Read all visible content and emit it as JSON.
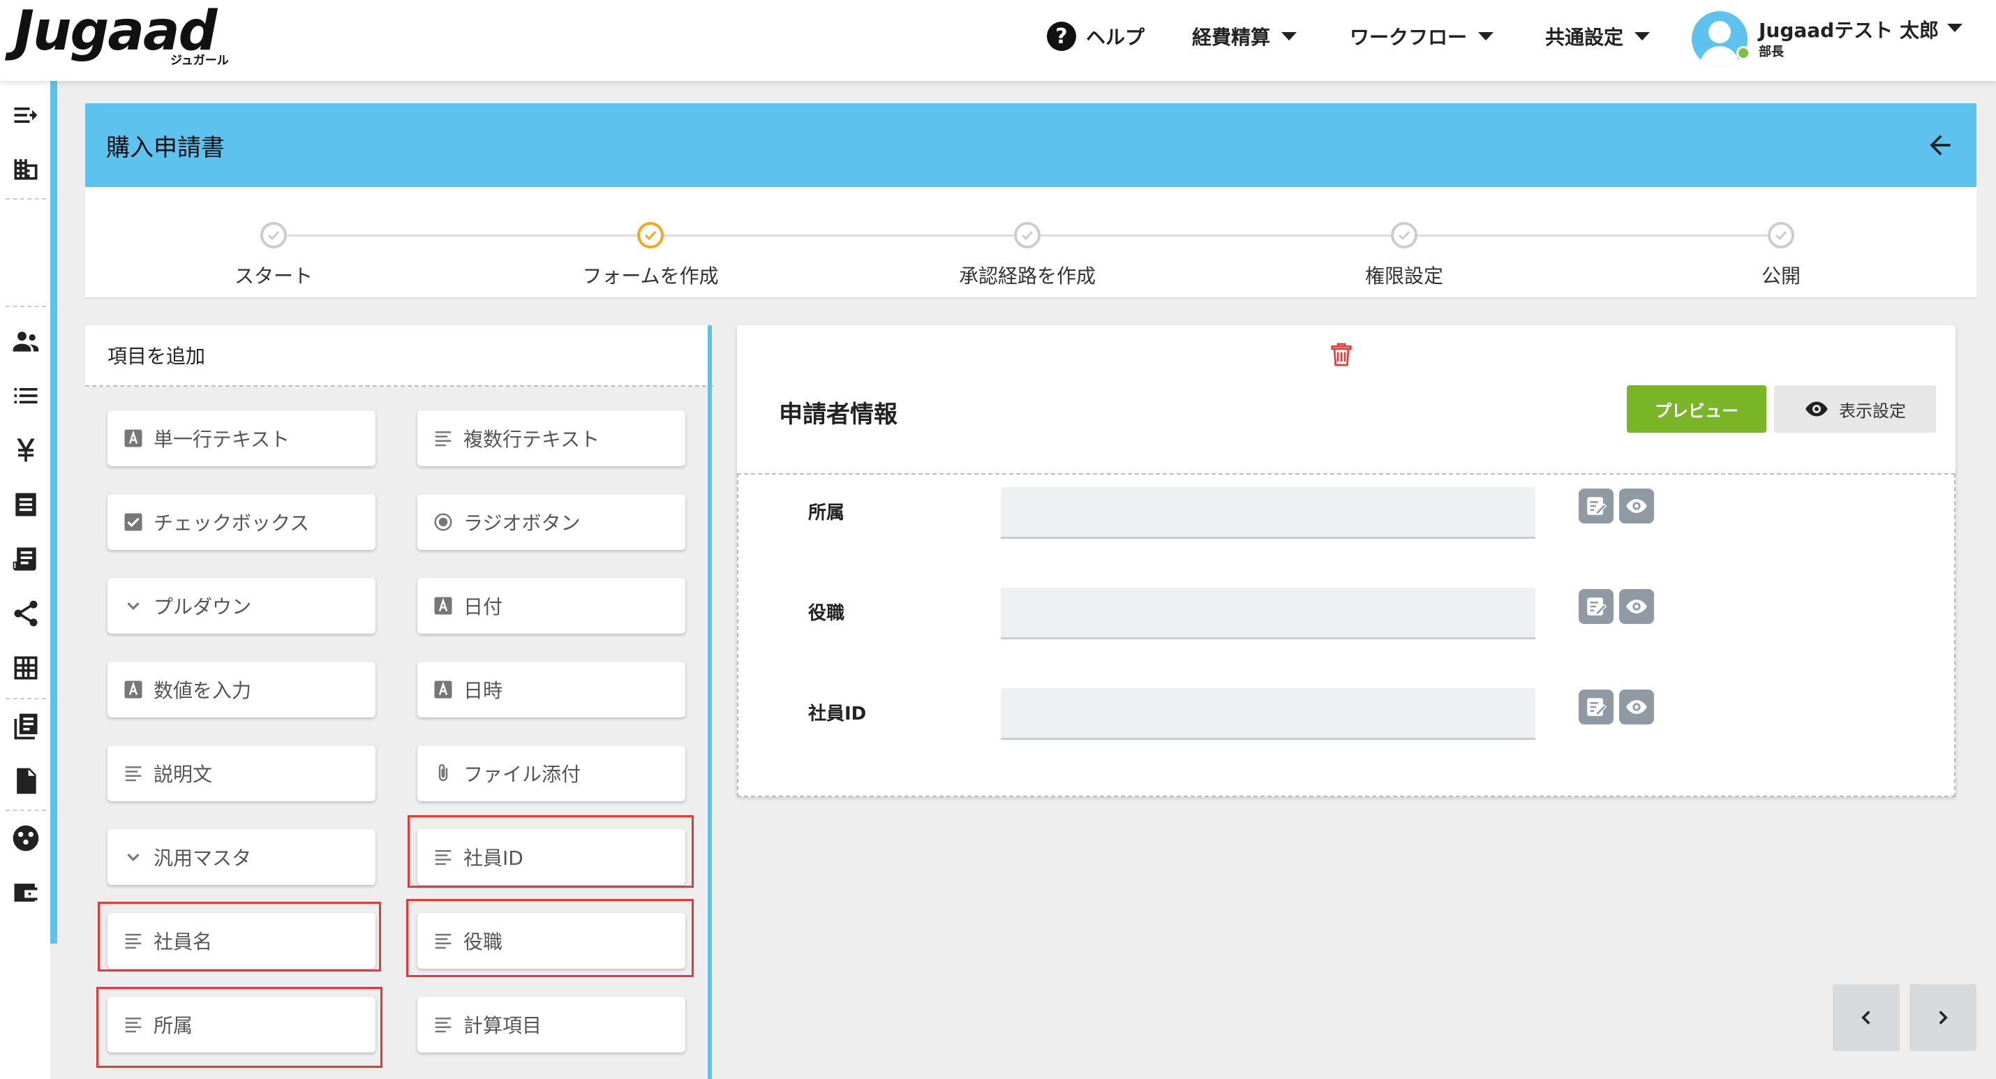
{
  "app": {
    "logo_text": "Jugaad",
    "logo_sub": "ジュガール"
  },
  "topnav": {
    "help": "ヘルプ",
    "expense": "経費精算",
    "workflow": "ワークフロー",
    "common_settings": "共通設定",
    "user_name": "Jugaadテスト 太郎",
    "user_role": "部長"
  },
  "page": {
    "title": "購入申請書"
  },
  "stepper": {
    "steps": [
      {
        "label": "スタート",
        "state": "done"
      },
      {
        "label": "フォームを作成",
        "state": "active"
      },
      {
        "label": "承認経路を作成",
        "state": "done"
      },
      {
        "label": "権限設定",
        "state": "done"
      },
      {
        "label": "公開",
        "state": "done"
      }
    ]
  },
  "palette": {
    "heading": "項目を追加",
    "items": [
      {
        "label": "単一行テキスト",
        "icon": "letter-a-icon"
      },
      {
        "label": "複数行テキスト",
        "icon": "lines-icon"
      },
      {
        "label": "チェックボックス",
        "icon": "checkbox-icon"
      },
      {
        "label": "ラジオボタン",
        "icon": "radio-icon"
      },
      {
        "label": "プルダウン",
        "icon": "chevron-down-icon"
      },
      {
        "label": "日付",
        "icon": "letter-a-icon"
      },
      {
        "label": "数値を入力",
        "icon": "letter-a-icon"
      },
      {
        "label": "日時",
        "icon": "letter-a-icon"
      },
      {
        "label": "説明文",
        "icon": "lines-icon"
      },
      {
        "label": "ファイル添付",
        "icon": "paperclip-icon"
      },
      {
        "label": "汎用マスタ",
        "icon": "chevron-down-icon"
      },
      {
        "label": "社員ID",
        "icon": "lines-icon",
        "highlighted": true
      },
      {
        "label": "社員名",
        "icon": "lines-icon",
        "highlighted": true
      },
      {
        "label": "役職",
        "icon": "lines-icon",
        "highlighted": true
      },
      {
        "label": "所属",
        "icon": "lines-icon",
        "highlighted": true
      },
      {
        "label": "計算項目",
        "icon": "lines-icon"
      }
    ]
  },
  "form": {
    "section_title": "申請者情報",
    "preview_label": "プレビュー",
    "display_settings_label": "表示設定",
    "fields": [
      {
        "label": "所属",
        "value": ""
      },
      {
        "label": "役職",
        "value": ""
      },
      {
        "label": "社員ID",
        "value": ""
      }
    ]
  },
  "colors": {
    "accent": "#5ec2ee",
    "preview_button": "#7ab528",
    "active_step": "#f5a623",
    "highlight_box": "#e53935",
    "delete_icon": "#e53935"
  }
}
